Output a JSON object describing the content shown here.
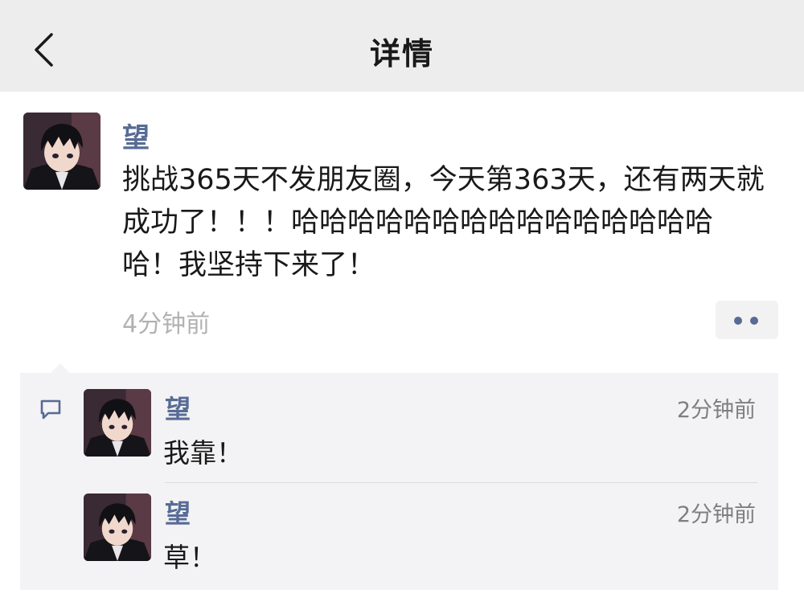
{
  "navbar": {
    "title": "详情",
    "back_icon": "chevron-left-icon"
  },
  "post": {
    "author": "望",
    "text": "挑战365天不发朋友圈，今天第363天，还有两天就成功了！！！哈哈哈哈哈哈哈哈哈哈哈哈哈哈哈哈！我坚持下来了！",
    "time": "4分钟前",
    "more_icon": "more-dots-icon"
  },
  "comments": [
    {
      "author": "望",
      "time": "2分钟前",
      "text": "我靠！"
    },
    {
      "author": "望",
      "time": "2分钟前",
      "text": "草！"
    }
  ],
  "colors": {
    "navbar_bg": "#ededed",
    "name_link": "#576b95",
    "comment_panel_bg": "#f3f3f5",
    "secondary_text": "#b2b2b2"
  }
}
